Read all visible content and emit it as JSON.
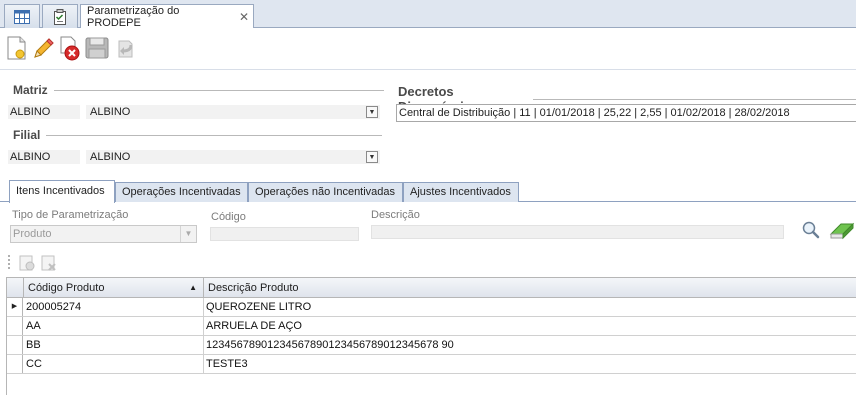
{
  "tabs": {
    "active_tab_label": "Parametrização do PRODEPE"
  },
  "matriz": {
    "title": "Matriz",
    "code": "ALBINO",
    "name": "ALBINO"
  },
  "filial": {
    "title": "Filial",
    "code": "ALBINO",
    "name": "ALBINO"
  },
  "decretos": {
    "title": "Decretos Disponíveis",
    "value": "Central de Distribuição | 11 | 01/01/2018 | 25,22 | 2,55 | 01/02/2018 | 28/02/2018"
  },
  "subtabs": [
    {
      "label": "Itens Incentivados"
    },
    {
      "label": "Operações Incentivadas"
    },
    {
      "label": "Operações não Incentivadas"
    },
    {
      "label": "Ajustes Incentivados"
    }
  ],
  "filters": {
    "tipo_label": "Tipo de Parametrização",
    "tipo_value": "Produto",
    "codigo_label": "Código",
    "descricao_label": "Descrição"
  },
  "grid": {
    "columns": [
      "Código Produto",
      "Descrição Produto"
    ],
    "rows": [
      {
        "codigo": "200005274",
        "descricao": "QUEROZENE LITRO"
      },
      {
        "codigo": "AA",
        "descricao": "ARRUELA DE AÇO"
      },
      {
        "codigo": "BB",
        "descricao": "12345678901234567890123456789012345678 90"
      },
      {
        "codigo": "CC",
        "descricao": "TESTE3"
      }
    ]
  },
  "colors": {
    "tab_border": "#9aa9c0",
    "header_bg": "#dfe4ec",
    "delete_red": "#d62b2b",
    "new_yellow": "#f3c531"
  }
}
